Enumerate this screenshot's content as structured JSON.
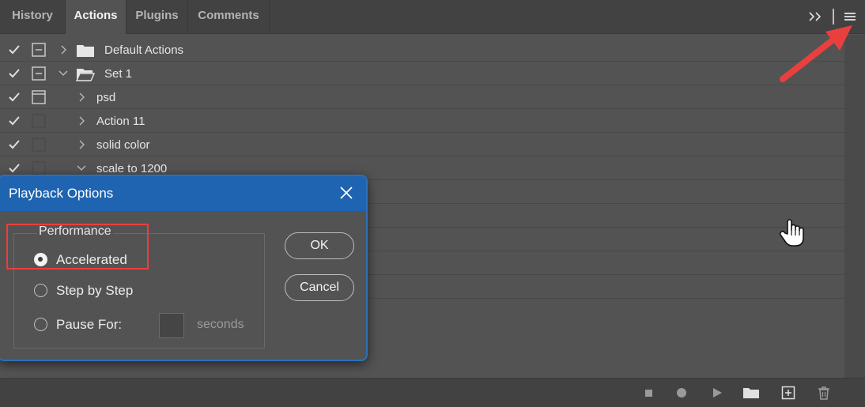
{
  "tabs": [
    {
      "label": "History",
      "active": false
    },
    {
      "label": "Actions",
      "active": true
    },
    {
      "label": "Plugins",
      "active": false
    },
    {
      "label": "Comments",
      "active": false
    }
  ],
  "toolbar": {
    "expand_icon": "double-chevron-right-icon",
    "menu_icon": "panel-menu-icon"
  },
  "actions": [
    {
      "label": "Default Actions",
      "type": "set",
      "expanded": false,
      "checked": true,
      "dialog_toggle": "visible"
    },
    {
      "label": "Set 1",
      "type": "set",
      "expanded": true,
      "checked": true,
      "dialog_toggle": "visible"
    },
    {
      "label": "psd",
      "type": "action",
      "expanded": false,
      "checked": true,
      "dialog_toggle": "visible"
    },
    {
      "label": "Action 11",
      "type": "action",
      "expanded": false,
      "checked": true,
      "dialog_toggle": "empty"
    },
    {
      "label": "solid color",
      "type": "action",
      "expanded": false,
      "checked": true,
      "dialog_toggle": "empty"
    },
    {
      "label": "scale to 1200",
      "type": "action",
      "expanded": true,
      "checked": true,
      "dialog_toggle": "empty"
    }
  ],
  "footer_icons": [
    "stop-icon",
    "record-icon",
    "play-icon",
    "new-set-folder-icon",
    "new-action-icon",
    "delete-icon"
  ],
  "dialog": {
    "title": "Playback Options",
    "group_label": "Performance",
    "options": [
      {
        "label": "Accelerated",
        "selected": true
      },
      {
        "label": "Step by Step",
        "selected": false
      },
      {
        "label": "Pause For:",
        "selected": false
      }
    ],
    "pause_value": "",
    "seconds_label": "seconds",
    "ok_label": "OK",
    "cancel_label": "Cancel"
  },
  "colors": {
    "annotation_red": "#e8403e",
    "dialog_title_blue": "#1f64b0"
  }
}
